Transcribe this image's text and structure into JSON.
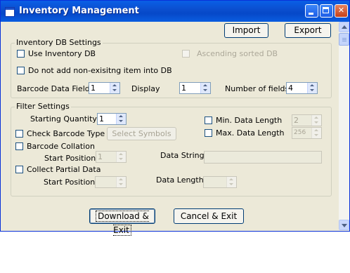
{
  "window": {
    "title": "Inventory Management"
  },
  "toolbar": {
    "import_label": "Import",
    "export_label": "Export"
  },
  "inventory_db": {
    "legend": "Inventory DB Settings",
    "use_inventory_db": "Use Inventory DB",
    "ascending_sorted_db": "Ascending sorted DB",
    "do_not_add": "Do not add non-exisitng item into DB",
    "barcode_data_field_label": "Barcode Data Field",
    "barcode_data_field_value": "1",
    "display_label": "Display",
    "display_value": "1",
    "number_of_fields_label": "Number of fields",
    "number_of_fields_value": "4"
  },
  "filter": {
    "legend": "Filter Settings",
    "starting_quantity_label": "Starting Quantity",
    "starting_quantity_value": "1",
    "min_data_length_label": "Min. Data Length",
    "min_data_length_value": "2",
    "check_barcode_type": "Check Barcode Type",
    "select_symbols_label": "Select Symbols",
    "max_data_length_label": "Max. Data Length",
    "max_data_length_value": "256",
    "barcode_collation": "Barcode Collation",
    "start_position_label": "Start Position",
    "collation_start_value": "1",
    "data_string_label": "Data String",
    "collect_partial_data": "Collect Partial Data",
    "partial_start_position_label": "Start Position",
    "data_length_label": "Data Length"
  },
  "footer": {
    "download_exit_label": "Download & Exit",
    "cancel_exit_label": "Cancel & Exit"
  },
  "colors": {
    "titlebar": "#0b4fd0",
    "face": "#ece9d8"
  }
}
